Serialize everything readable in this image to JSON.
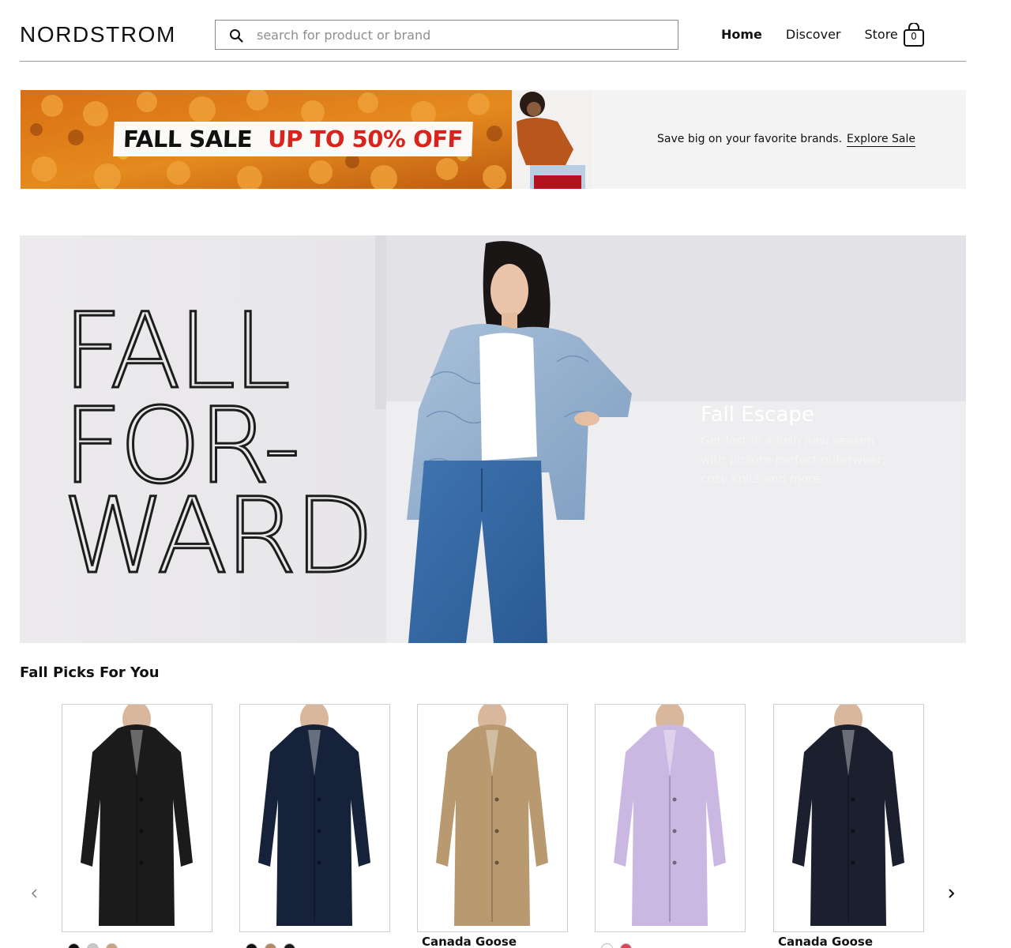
{
  "header": {
    "logo": "NORDSTROM",
    "search_placeholder": "search for product or brand",
    "nav": [
      "Home",
      "Discover",
      "Store"
    ],
    "bag_count": "0"
  },
  "sale_banner": {
    "label_left": "FALL SALE",
    "label_right": "UP TO 50% OFF",
    "text": "Save big on your favorite brands.",
    "link": "Explore Sale",
    "accent_color": "#d8241c"
  },
  "hero": {
    "title_lines": [
      "FALL",
      "FOR-",
      "WARD"
    ],
    "heading": "Fall Escape",
    "subtext": "Get lost in a lush new season with picture-perfect outerwear, cozy knits and more"
  },
  "picks": {
    "title": "Fall Picks For You",
    "products": [
      {
        "brand": "",
        "coat_color": "#1b1b1b",
        "swatches": [
          "#111111",
          "#c8c8c8",
          "#c9a27e"
        ]
      },
      {
        "brand": "",
        "coat_color": "#16213a",
        "swatches": [
          "#111111",
          "#b08a5a",
          "#1a1a1a"
        ]
      },
      {
        "brand": "Canada Goose",
        "coat_color": "#b99a70",
        "swatches": []
      },
      {
        "brand": "",
        "coat_color": "#cbb8e2",
        "swatches": [
          "#ffffff",
          "#d9475e"
        ]
      },
      {
        "brand": "Canada Goose",
        "coat_color": "#1c1f2e",
        "swatches": []
      }
    ]
  }
}
